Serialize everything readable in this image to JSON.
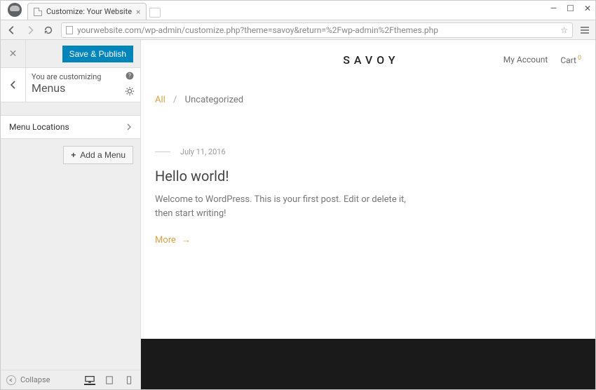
{
  "browser": {
    "tab_title": "Customize: Your Website",
    "url": "yourwebsite.com/wp-admin/customize.php?theme=savoy&return=%2Fwp-admin%2Fthemes.php"
  },
  "customizer": {
    "save_label": "Save & Publish",
    "heading_small": "You are customizing",
    "heading_title": "Menus",
    "item_label": "Menu Locations",
    "add_menu_label": "Add a Menu",
    "collapse_label": "Collapse"
  },
  "site": {
    "brand": "SAVOY",
    "account_label": "My Account",
    "cart_label": "Cart",
    "cart_count": "0",
    "crumb_all": "All",
    "crumb_sep": "/",
    "crumb_cat": "Uncategorized",
    "post_date": "July 11, 2016",
    "post_title": "Hello world!",
    "post_body": "Welcome to WordPress. This is your first post. Edit or delete it, then start writing!",
    "post_more": "More"
  }
}
